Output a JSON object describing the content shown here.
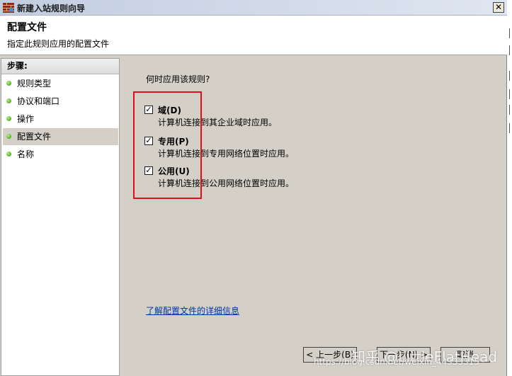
{
  "window": {
    "title": "新建入站规则向导",
    "close_glyph": "✕"
  },
  "header": {
    "title": "配置文件",
    "subtitle": "指定此规则应用的配置文件"
  },
  "sidebar": {
    "steps_label": "步骤:",
    "items": [
      {
        "label": "规则类型",
        "active": false
      },
      {
        "label": "协议和端口",
        "active": false
      },
      {
        "label": "操作",
        "active": false
      },
      {
        "label": "配置文件",
        "active": true
      },
      {
        "label": "名称",
        "active": false
      }
    ]
  },
  "main": {
    "question": "何时应用该规则?",
    "options": [
      {
        "label": "域(D)",
        "description": "计算机连接到其企业域时应用。",
        "checked": true
      },
      {
        "label": "专用(P)",
        "description": "计算机连接到专用网络位置时应用。",
        "checked": true
      },
      {
        "label": "公用(U)",
        "description": "计算机连接到公用网络位置时应用。",
        "checked": true
      }
    ],
    "learn_more": "了解配置文件的详细信息"
  },
  "buttons": {
    "back": "< 上一步(B)",
    "next": "下一步(N) >",
    "cancel": "取消"
  },
  "watermark": {
    "text": "知乎 @LittleFlatHead",
    "url": "https://blog.csdn.net/weixin_44333315"
  },
  "colors": {
    "highlight_box": "#e0101a",
    "link": "#0033aa",
    "dialog_bg": "#d4d0c8"
  }
}
